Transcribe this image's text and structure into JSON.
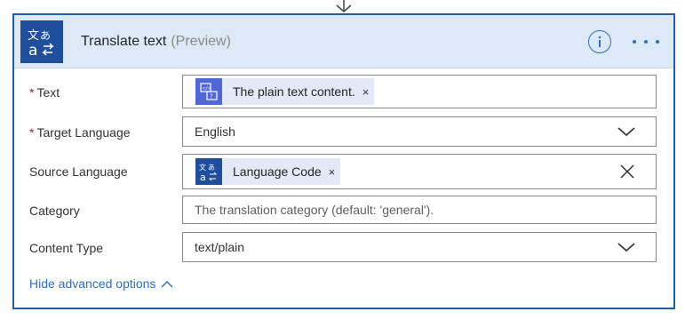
{
  "card": {
    "title": "Translate text",
    "preview_tag": "(Preview)",
    "action_icon": "translate-icon",
    "info_icon": "info-icon",
    "more_icon": "more-options-icon"
  },
  "fields": {
    "text": {
      "label": "Text",
      "required": "*",
      "token_label": "The plain text content.",
      "token_icon": "content-token-icon",
      "token_remove": "×"
    },
    "target_language": {
      "label": "Target Language",
      "required": "*",
      "value": "English"
    },
    "source_language": {
      "label": "Source Language",
      "token_label": "Language Code",
      "token_icon": "translate-token-icon",
      "token_remove": "×"
    },
    "category": {
      "label": "Category",
      "placeholder": "The translation category (default: 'general')."
    },
    "content_type": {
      "label": "Content Type",
      "value": "text/plain"
    }
  },
  "advanced": {
    "toggle_label": "Hide advanced options"
  },
  "colors": {
    "header_bg": "#dde9f6",
    "border_accent": "#1f5fa6",
    "link": "#2b6fc7",
    "required": "#a4262c"
  }
}
